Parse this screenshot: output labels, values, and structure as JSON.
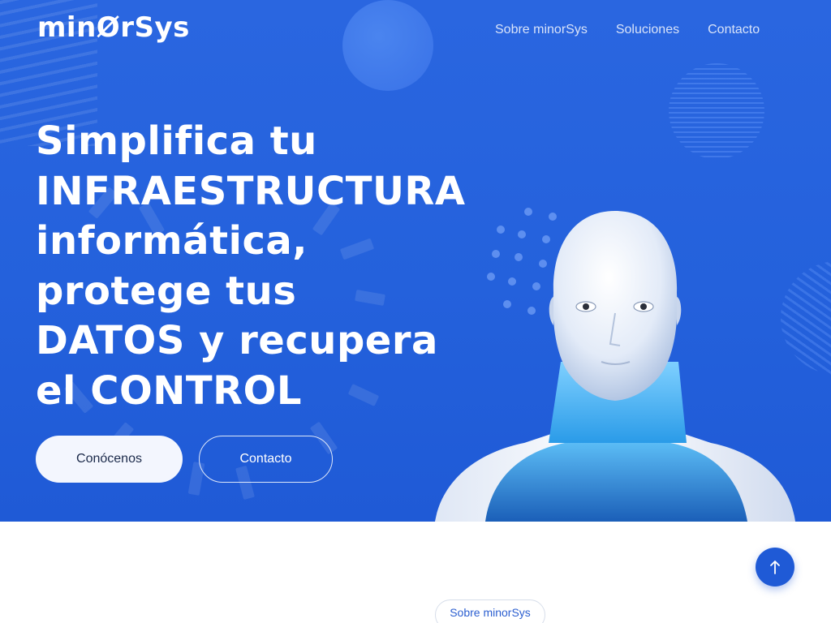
{
  "brand": {
    "logo_text": "minØrSys"
  },
  "nav": {
    "items": [
      {
        "label": "Sobre minorSys"
      },
      {
        "label": "Soluciones"
      },
      {
        "label": "Contacto"
      }
    ]
  },
  "hero": {
    "headline_lines": [
      "Simplifica tu",
      "INFRAESTRUCTURA",
      "informática,",
      "protege tus",
      "DATOS y recupera",
      "el CONTROL"
    ],
    "primary_button": "Conócenos",
    "secondary_button": "Contacto",
    "background_color": "#2461dc"
  },
  "scroll_top": {
    "icon": "arrow-up-icon"
  },
  "section_tag": {
    "label": "Sobre minorSys"
  },
  "colors": {
    "accent": "#2461dc",
    "tag_text": "#2c5fd0"
  }
}
